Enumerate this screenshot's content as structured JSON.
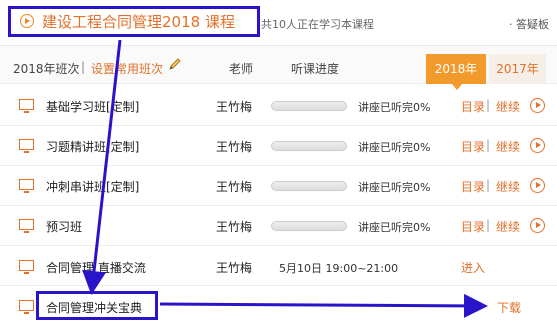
{
  "header": {
    "title": "建设工程合同管理2018 课程",
    "learners": "共10人正在学习本课程",
    "qa_link": "答疑板"
  },
  "table_header": {
    "class_year": "2018年班次",
    "separator": "|",
    "set_common": "设置常用班次",
    "teacher": "老师",
    "progress": "听课进度",
    "tabs": [
      "2018年",
      "2017年"
    ],
    "active_tab": "2018年"
  },
  "rows": [
    {
      "name": "基础学习班[定制]",
      "teacher": "王竹梅",
      "progress": 0,
      "status": "讲座已听完0%",
      "links": [
        "目录",
        "继续"
      ]
    },
    {
      "name": "习题精讲班[定制]",
      "teacher": "王竹梅",
      "progress": 0,
      "status": "讲座已听完0%",
      "links": [
        "目录",
        "继续"
      ]
    },
    {
      "name": "冲刺串讲班[定制]",
      "teacher": "王竹梅",
      "progress": 0,
      "status": "讲座已听完0%",
      "links": [
        "目录",
        "继续"
      ]
    },
    {
      "name": "预习班",
      "teacher": "王竹梅",
      "progress": 0,
      "status": "讲座已听完0%",
      "links": [
        "目录",
        "继续"
      ]
    }
  ],
  "live_row": {
    "name": "合同管理  直播交流",
    "teacher": "王竹梅",
    "time": "5月10日 19:00~21:00",
    "action": "进入"
  },
  "download_row": {
    "name": "合同管理冲关宝典",
    "action": "下载"
  },
  "colors": {
    "accent": "#e2702a",
    "tab_active": "#f39a2c",
    "annotation": "#2a14c9"
  }
}
